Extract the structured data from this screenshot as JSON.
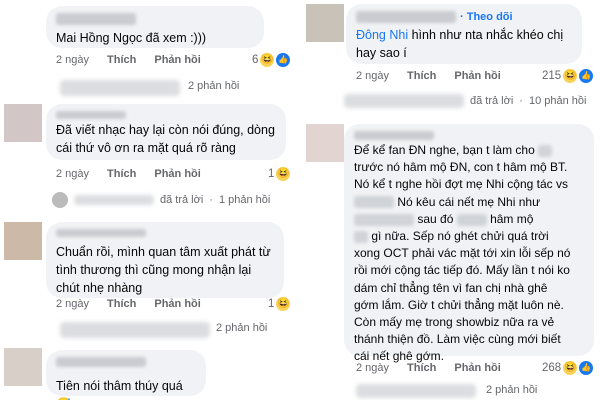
{
  "left": {
    "c1": {
      "text": "Mai Hồng Ngọc đã xem :)))",
      "time": "2 ngày",
      "like": "Thích",
      "reply": "Phản hồi",
      "count": "6",
      "replies": "2 phản hồi"
    },
    "c2": {
      "text": "Đã viết nhạc hay lại còn nói đúng, dòng cái thứ vô ơn ra mặt quá rõ ràng",
      "time": "2 ngày",
      "like": "Thích",
      "reply": "Phản hồi",
      "count": "1",
      "replied": "đã trả lời",
      "replies": "1 phản hồi"
    },
    "c3": {
      "text": "Chuẩn rồi, mình quan tâm xuất phát từ tình thương thì cũng mong nhận lại chút nhẹ nhàng",
      "time": "2 ngày",
      "like": "Thích",
      "reply": "Phản hồi",
      "count": "1",
      "replies": "2 phản hồi"
    },
    "c4": {
      "text": "Tiên nói thâm thúy quá😅"
    }
  },
  "right": {
    "c1": {
      "follow": "Theo dõi",
      "mention": "Đông Nhi",
      "text": " hình như nta nhắc khéo chị hay sao í",
      "time": "2 ngày",
      "like": "Thích",
      "reply": "Phản hồi",
      "count": "215",
      "replied": "đã trả lời",
      "replies": "10 phản hồi"
    },
    "c2": {
      "l1": "Để kể fan ĐN nghe, bạn t làm cho",
      "l2": "trước nó hâm mộ ĐN, con t hâm mộ BT.",
      "l3": "Nó kể t nghe hồi đợt mẹ Nhi cộng tác vs",
      "l4": "Nó kêu cái nết mẹ Nhi như",
      "l5a": "sau đó",
      "l5b": "hâm mộ",
      "l6": "gì nữa. Sếp nó ghét chửi quá trời",
      "l7": "xong OCT phải vác mặt tới xin lỗi sếp nó",
      "l8": "rồi mới cộng tác tiếp đó. Mấy lần t nói ko",
      "l9": "dám chỉ thẳng tên vì fan chị nhà ghê",
      "l10": "gớm lắm. Giờ t chửi thẳng mặt luôn nè.",
      "l11": "Còn mấy mẹ trong showbiz nữa ra vẻ",
      "l12": "thánh thiện đồ. Làm việc cùng mới biết",
      "l13": "cái nết ghê gớm.",
      "time": "2 ngày",
      "like": "Thích",
      "reply": "Phản hồi",
      "count": "268",
      "replies": "2 phản hồi"
    }
  }
}
